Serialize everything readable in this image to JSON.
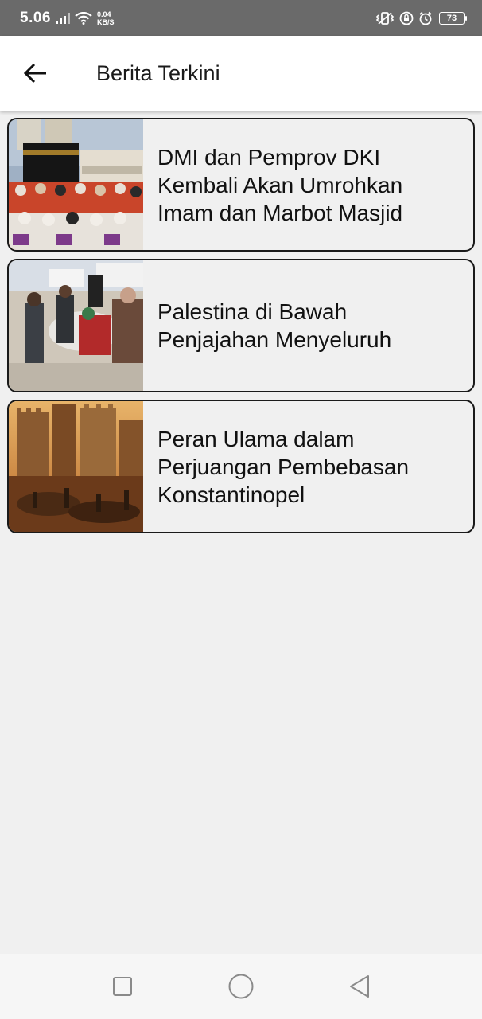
{
  "status_bar": {
    "time": "5.06",
    "net_speed_value": "0.04",
    "net_speed_unit": "KB/S",
    "battery_level": "73",
    "icons": [
      "signal-icon",
      "wifi-icon",
      "vibrate-icon",
      "lock-rotation-icon",
      "alarm-icon",
      "battery-icon"
    ]
  },
  "app_bar": {
    "title": "Berita Terkini",
    "back_icon": "arrow-left-icon"
  },
  "news": [
    {
      "title": "DMI dan Pemprov DKI Kembali Akan Umrohkan Imam dan Marbot Masjid",
      "image": "umrah-group-photo"
    },
    {
      "title": "Palestina di Bawah Penjajahan Menyeluruh",
      "image": "palestine-arrest-photo"
    },
    {
      "title": "Peran Ulama dalam Perjuangan Pembebasan Konstantinopel",
      "image": "constantinople-siege-painting"
    }
  ],
  "nav_bar": {
    "icons": [
      "recent-apps-icon",
      "home-icon",
      "back-icon"
    ]
  },
  "colors": {
    "status_bar_bg": "#6a6a6a",
    "app_bar_bg": "#ffffff",
    "page_bg": "#f0f0f0",
    "card_border": "#1a1a1a"
  }
}
